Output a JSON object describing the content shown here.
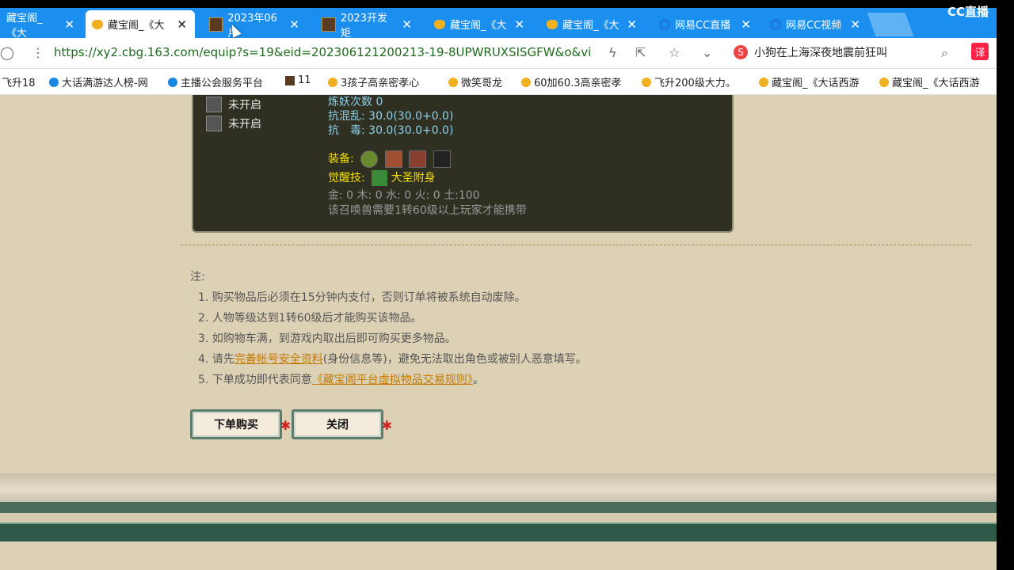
{
  "tabs": [
    {
      "label": "藏宝阁_《大",
      "icon": "none"
    },
    {
      "label": "藏宝阁_《大",
      "icon": "yellow",
      "active": true
    },
    {
      "label": "2023年06月",
      "icon": "game"
    },
    {
      "label": "2023开发矩",
      "icon": "game"
    },
    {
      "label": "藏宝阁_《大",
      "icon": "yellow"
    },
    {
      "label": "藏宝阁_《大",
      "icon": "yellow"
    },
    {
      "label": "网易CC直播",
      "icon": "cc"
    },
    {
      "label": "网易CC视频",
      "icon": "cc"
    }
  ],
  "cc_logo": "CC直播",
  "address": {
    "url": "https://xy2.cbg.163.com/equip?s=19&eid=202306121200213-19-8UPWRUXSISGFW&o&vi",
    "search_text": "小狗在上海深夜地震前狂叫",
    "translate_label": "译"
  },
  "bookmarks": [
    {
      "label": "飞升18",
      "icon": "none"
    },
    {
      "label": "大话满游达人榜-网",
      "icon": "blue"
    },
    {
      "label": "主播公会服务平台",
      "icon": "blue"
    },
    {
      "label": "11",
      "icon": "game"
    },
    {
      "label": "3孩子高亲密孝心",
      "icon": "yellow"
    },
    {
      "label": "微笑哥龙",
      "icon": "yellow"
    },
    {
      "label": "60加60.3高亲密孝",
      "icon": "yellow"
    },
    {
      "label": "飞升200级大力。",
      "icon": "yellow"
    },
    {
      "label": "藏宝阁_《大话西游",
      "icon": "yellow"
    },
    {
      "label": "藏宝阁_《大话西游",
      "icon": "yellow"
    }
  ],
  "pet_panel": {
    "slots": [
      "未开启",
      "未开启"
    ],
    "refine_count": "炼妖次数 0",
    "resist_confusion": "抗混乱: 30.0(30.0+0.0)",
    "resist_poison": "抗　毒: 30.0(30.0+0.0)",
    "equip_label": "装备:",
    "awaken_label": "觉醒技:",
    "awaken_skill": "大圣附身",
    "elements": "金: 0 木: 0 水: 0 火: 0 土:100",
    "requirement": "该召唤兽需要1转60级以上玩家才能携带"
  },
  "notes": {
    "title": "注:",
    "items": [
      "1. 购买物品后必须在15分钟内支付，否则订单将被系统自动废除。",
      "2. 人物等级达到1转60级后才能购买该物品。",
      "3. 如购物车满，到游戏内取出后即可购买更多物品。"
    ],
    "item4_pre": "4. 请先",
    "item4_link": "完善帐号安全资料",
    "item4_post": "(身份信息等)，避免无法取出角色或被别人恶意填写。",
    "item5_pre": "5. 下单成功即代表同意",
    "item5_link": "《藏宝阁平台虚拟物品交易规则》",
    "item5_post": "。"
  },
  "buttons": {
    "buy": "下单购买",
    "close": "关闭"
  }
}
